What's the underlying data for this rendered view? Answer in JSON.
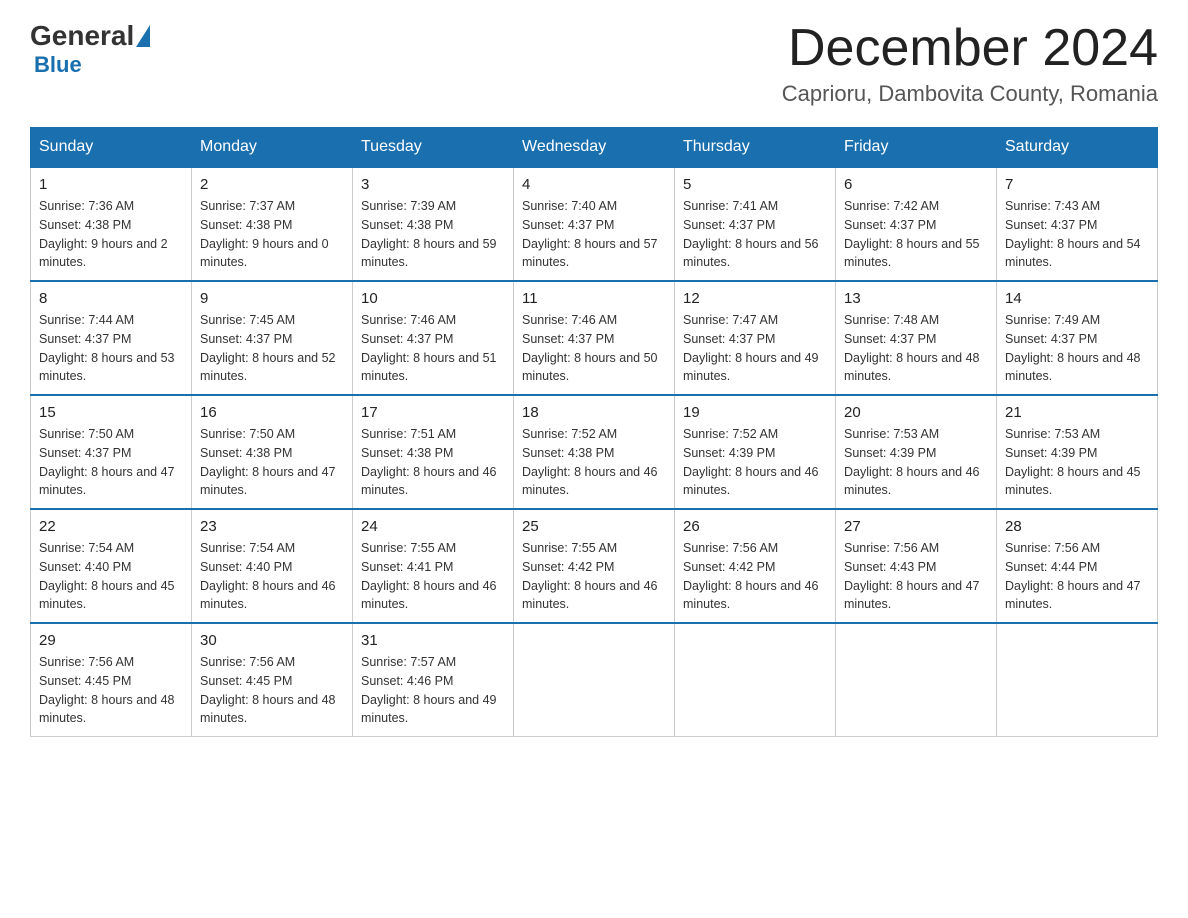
{
  "header": {
    "logo": {
      "general": "General",
      "blue": "Blue"
    },
    "title": "December 2024",
    "location": "Caprioru, Dambovita County, Romania"
  },
  "days_of_week": [
    "Sunday",
    "Monday",
    "Tuesday",
    "Wednesday",
    "Thursday",
    "Friday",
    "Saturday"
  ],
  "weeks": [
    [
      {
        "day": "1",
        "sunrise": "7:36 AM",
        "sunset": "4:38 PM",
        "daylight": "9 hours and 2 minutes."
      },
      {
        "day": "2",
        "sunrise": "7:37 AM",
        "sunset": "4:38 PM",
        "daylight": "9 hours and 0 minutes."
      },
      {
        "day": "3",
        "sunrise": "7:39 AM",
        "sunset": "4:38 PM",
        "daylight": "8 hours and 59 minutes."
      },
      {
        "day": "4",
        "sunrise": "7:40 AM",
        "sunset": "4:37 PM",
        "daylight": "8 hours and 57 minutes."
      },
      {
        "day": "5",
        "sunrise": "7:41 AM",
        "sunset": "4:37 PM",
        "daylight": "8 hours and 56 minutes."
      },
      {
        "day": "6",
        "sunrise": "7:42 AM",
        "sunset": "4:37 PM",
        "daylight": "8 hours and 55 minutes."
      },
      {
        "day": "7",
        "sunrise": "7:43 AM",
        "sunset": "4:37 PM",
        "daylight": "8 hours and 54 minutes."
      }
    ],
    [
      {
        "day": "8",
        "sunrise": "7:44 AM",
        "sunset": "4:37 PM",
        "daylight": "8 hours and 53 minutes."
      },
      {
        "day": "9",
        "sunrise": "7:45 AM",
        "sunset": "4:37 PM",
        "daylight": "8 hours and 52 minutes."
      },
      {
        "day": "10",
        "sunrise": "7:46 AM",
        "sunset": "4:37 PM",
        "daylight": "8 hours and 51 minutes."
      },
      {
        "day": "11",
        "sunrise": "7:46 AM",
        "sunset": "4:37 PM",
        "daylight": "8 hours and 50 minutes."
      },
      {
        "day": "12",
        "sunrise": "7:47 AM",
        "sunset": "4:37 PM",
        "daylight": "8 hours and 49 minutes."
      },
      {
        "day": "13",
        "sunrise": "7:48 AM",
        "sunset": "4:37 PM",
        "daylight": "8 hours and 48 minutes."
      },
      {
        "day": "14",
        "sunrise": "7:49 AM",
        "sunset": "4:37 PM",
        "daylight": "8 hours and 48 minutes."
      }
    ],
    [
      {
        "day": "15",
        "sunrise": "7:50 AM",
        "sunset": "4:37 PM",
        "daylight": "8 hours and 47 minutes."
      },
      {
        "day": "16",
        "sunrise": "7:50 AM",
        "sunset": "4:38 PM",
        "daylight": "8 hours and 47 minutes."
      },
      {
        "day": "17",
        "sunrise": "7:51 AM",
        "sunset": "4:38 PM",
        "daylight": "8 hours and 46 minutes."
      },
      {
        "day": "18",
        "sunrise": "7:52 AM",
        "sunset": "4:38 PM",
        "daylight": "8 hours and 46 minutes."
      },
      {
        "day": "19",
        "sunrise": "7:52 AM",
        "sunset": "4:39 PM",
        "daylight": "8 hours and 46 minutes."
      },
      {
        "day": "20",
        "sunrise": "7:53 AM",
        "sunset": "4:39 PM",
        "daylight": "8 hours and 46 minutes."
      },
      {
        "day": "21",
        "sunrise": "7:53 AM",
        "sunset": "4:39 PM",
        "daylight": "8 hours and 45 minutes."
      }
    ],
    [
      {
        "day": "22",
        "sunrise": "7:54 AM",
        "sunset": "4:40 PM",
        "daylight": "8 hours and 45 minutes."
      },
      {
        "day": "23",
        "sunrise": "7:54 AM",
        "sunset": "4:40 PM",
        "daylight": "8 hours and 46 minutes."
      },
      {
        "day": "24",
        "sunrise": "7:55 AM",
        "sunset": "4:41 PM",
        "daylight": "8 hours and 46 minutes."
      },
      {
        "day": "25",
        "sunrise": "7:55 AM",
        "sunset": "4:42 PM",
        "daylight": "8 hours and 46 minutes."
      },
      {
        "day": "26",
        "sunrise": "7:56 AM",
        "sunset": "4:42 PM",
        "daylight": "8 hours and 46 minutes."
      },
      {
        "day": "27",
        "sunrise": "7:56 AM",
        "sunset": "4:43 PM",
        "daylight": "8 hours and 47 minutes."
      },
      {
        "day": "28",
        "sunrise": "7:56 AM",
        "sunset": "4:44 PM",
        "daylight": "8 hours and 47 minutes."
      }
    ],
    [
      {
        "day": "29",
        "sunrise": "7:56 AM",
        "sunset": "4:45 PM",
        "daylight": "8 hours and 48 minutes."
      },
      {
        "day": "30",
        "sunrise": "7:56 AM",
        "sunset": "4:45 PM",
        "daylight": "8 hours and 48 minutes."
      },
      {
        "day": "31",
        "sunrise": "7:57 AM",
        "sunset": "4:46 PM",
        "daylight": "8 hours and 49 minutes."
      },
      null,
      null,
      null,
      null
    ]
  ]
}
